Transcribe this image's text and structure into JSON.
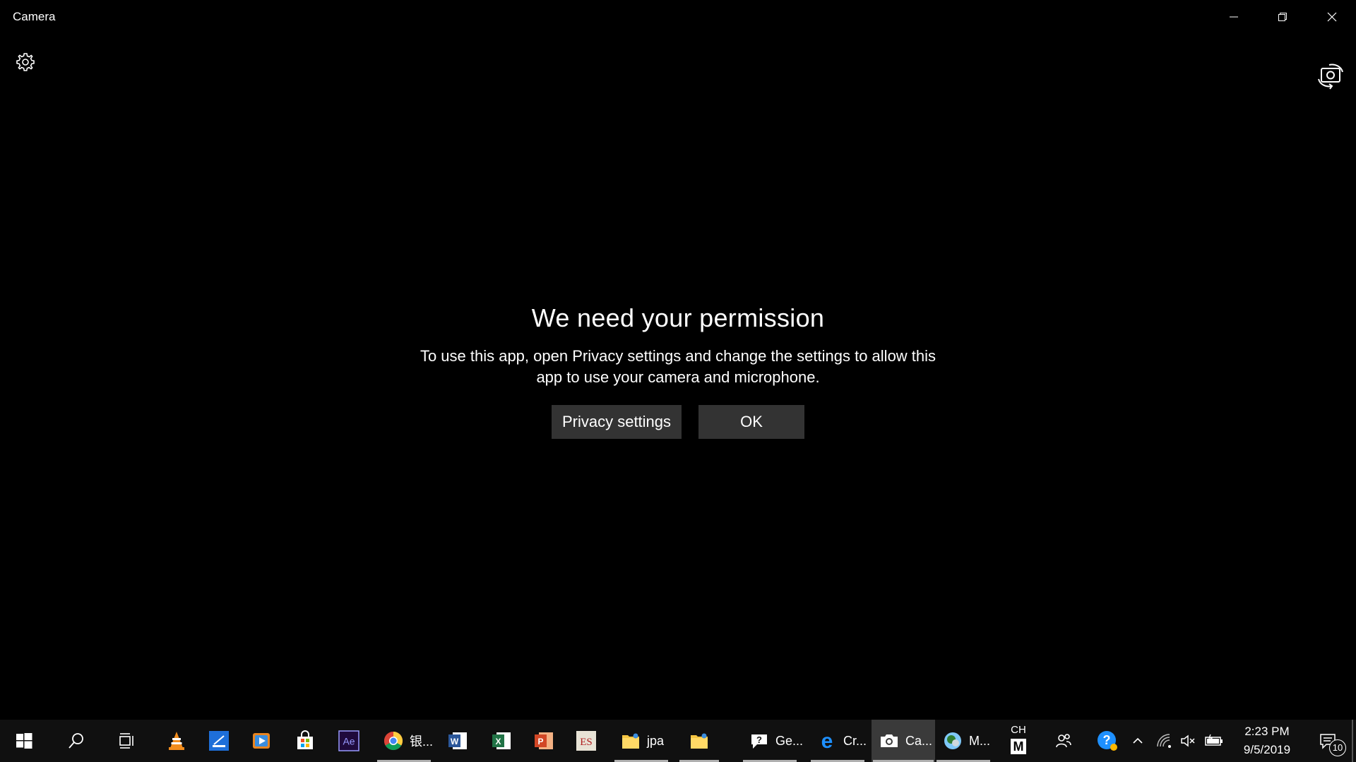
{
  "window": {
    "title": "Camera"
  },
  "dialog": {
    "heading": "We need your permission",
    "body": "To use this app, open Privacy settings and change the settings to allow this app to use your camera and microphone.",
    "privacy_button": "Privacy settings",
    "ok_button": "OK"
  },
  "taskbar": {
    "labeled_apps": [
      {
        "label": "银...",
        "icon": "chrome-icon"
      },
      {
        "label": "jpa",
        "icon": "folder-icon"
      },
      {
        "label": "Ge...",
        "icon": "help-chat-icon"
      },
      {
        "label": "Cr...",
        "icon": "edge-icon"
      },
      {
        "label": "Ca...",
        "icon": "camera-icon"
      },
      {
        "label": "M...",
        "icon": "maps-icon"
      }
    ],
    "ime": {
      "lang": "CH",
      "mode": "M"
    },
    "clock": {
      "time": "2:23 PM",
      "date": "9/5/2019"
    },
    "notifications_count": "10"
  },
  "colors": {
    "background": "#000000",
    "button": "#333333",
    "taskbar": "#101010",
    "active_task": "#3a3a3a"
  }
}
